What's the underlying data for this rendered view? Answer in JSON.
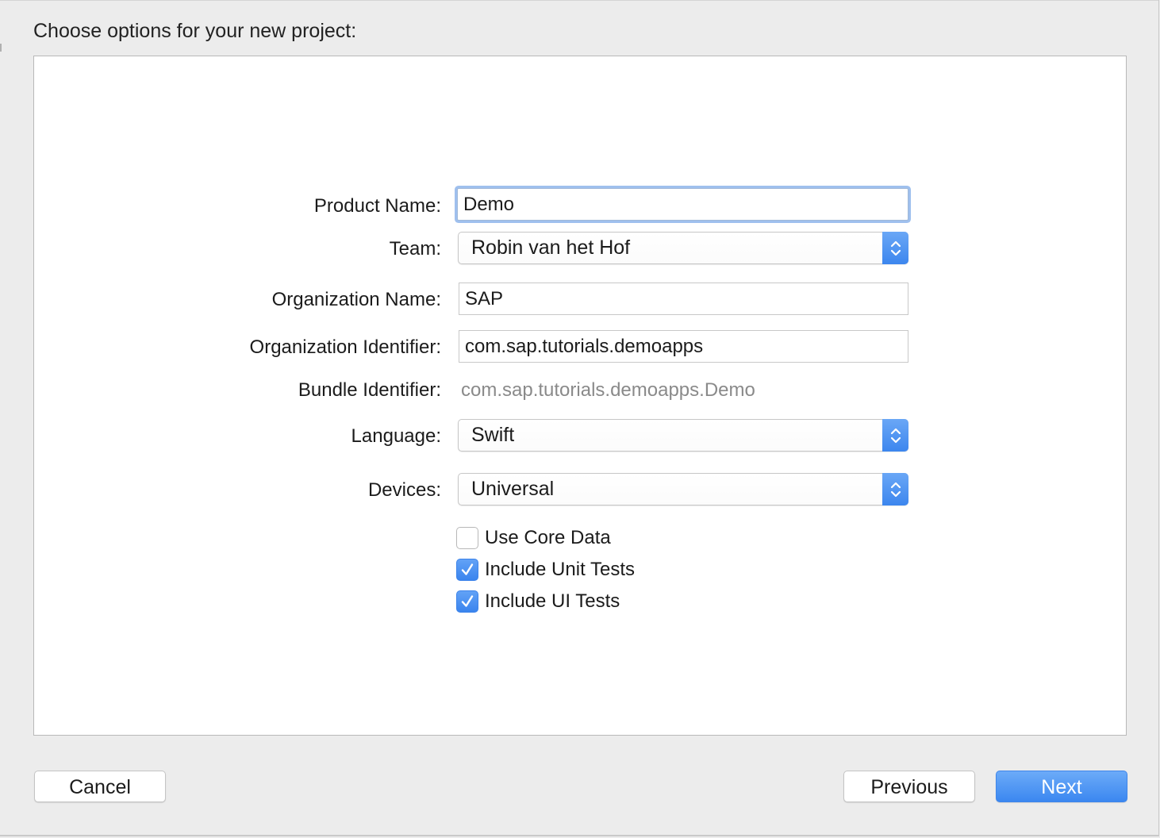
{
  "dialog": {
    "heading": "Choose options for your new project:"
  },
  "form": {
    "product_name": {
      "label": "Product Name:",
      "value": "Demo"
    },
    "team": {
      "label": "Team:",
      "value": "Robin van het Hof"
    },
    "organization_name": {
      "label": "Organization Name:",
      "value": "SAP"
    },
    "organization_identifier": {
      "label": "Organization Identifier:",
      "value": "com.sap.tutorials.demoapps"
    },
    "bundle_identifier": {
      "label": "Bundle Identifier:",
      "value": "com.sap.tutorials.demoapps.Demo"
    },
    "language": {
      "label": "Language:",
      "value": "Swift"
    },
    "devices": {
      "label": "Devices:",
      "value": "Universal"
    },
    "checkboxes": [
      {
        "label": "Use Core Data",
        "checked": false
      },
      {
        "label": "Include Unit Tests",
        "checked": true
      },
      {
        "label": "Include UI Tests",
        "checked": true
      }
    ]
  },
  "footer": {
    "cancel_label": "Cancel",
    "previous_label": "Previous",
    "next_label": "Next"
  },
  "colors": {
    "accent": "#3b87f0",
    "focus_ring": "#9fc0ee",
    "background": "#ececec",
    "panel": "#ffffff",
    "secondary_text": "#8a8a8a"
  },
  "icons": {
    "popup_stepper": "up-down-chevron-icon",
    "checkmark": "checkmark-icon"
  }
}
